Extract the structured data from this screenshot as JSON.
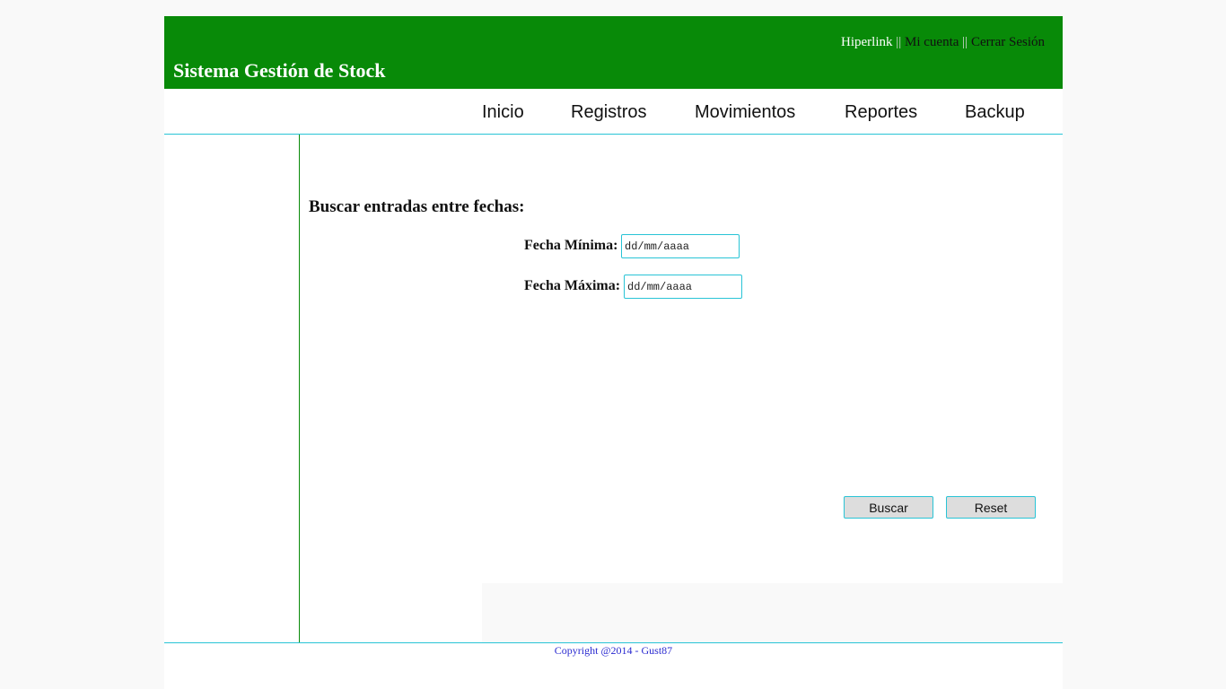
{
  "header": {
    "title": "Sistema Gestión de Stock",
    "links": [
      {
        "label": "Hiperlink",
        "color": "#ffffff"
      },
      {
        "label": "Mi cuenta",
        "color": "#111111"
      },
      {
        "label": "Cerrar Sesión",
        "color": "#111111"
      }
    ],
    "separator": "||",
    "background": "#088a08"
  },
  "nav": {
    "items": [
      {
        "label": "Inicio"
      },
      {
        "label": "Registros"
      },
      {
        "label": "Movimientos"
      },
      {
        "label": "Reportes"
      },
      {
        "label": "Backup"
      }
    ]
  },
  "search": {
    "heading": "Buscar entradas entre fechas:",
    "min_label": "Fecha Mínima:",
    "min_placeholder": "dd/mm/aaaa",
    "max_label": "Fecha Máxima:",
    "max_placeholder": "dd/mm/aaaa",
    "search_button": "Buscar",
    "reset_button": "Reset"
  },
  "footer": {
    "copyright": "Copyright @2014 - Gust87"
  },
  "colors": {
    "brand_green": "#088a08",
    "accent_cyan": "#29c4d6",
    "footer_text": "#2a2ad0"
  }
}
